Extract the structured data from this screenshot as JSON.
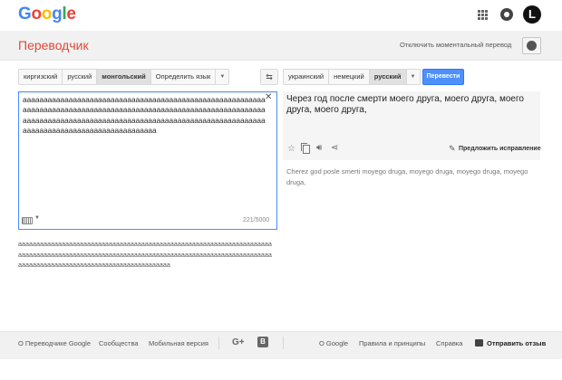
{
  "header": {
    "logo": [
      "G",
      "o",
      "o",
      "g",
      "l",
      "e"
    ],
    "logo_colors": [
      "#4285f4",
      "#ea4335",
      "#fbbc05",
      "#4285f4",
      "#34a853",
      "#ea4335"
    ],
    "avatar_letter": "L"
  },
  "titlebar": {
    "title": "Переводчик",
    "instant_toggle": "Отключить моментальный перевод"
  },
  "source_langs": [
    "киргизский",
    "русский",
    "монгольский",
    "Определить язык"
  ],
  "target_langs": [
    "украинский",
    "немецкий",
    "русский"
  ],
  "swap_label": "⇆",
  "translate_button": "Перевести",
  "source": {
    "text": "aaaaaaaaaaaaaaaaaaaaaaaaaaaaaaaaaaaaaaaaaaaaaaaaaaaaaaaaaaaaaaaaaaaaaaaaaaaaaaaaaaaaaaaaaaaaaaaaaaaaaaaaaaaaaaaaaaaaaaaaaaaaaaaaaaaaaaaaaaaaaaaaaaaaaaaaaaaaaaaaaaaaaaaaaaaaaaaaaaaaaaaaaaaaaaaaaaaaaaaaaaaaaa",
    "char_count": "221/5000",
    "below_text": "aaaaaaaaaaaaaaaaaaaaaaaaaaaaaaaaaaaaaaaaaaaaaaaaaaaaaaaaaaaaaaaaaaaaaaaaaaaaaaaaaaaaaaaaaaaaaaaaaaaaaaaaaaaaaaaaaaaaaaaaaaaaaaaaaaaaaaaaaaaaaaaaaaaaaaaaaaaaaaaaaaaaaaaaaaaaaaaaaaaaaa"
  },
  "result": {
    "text": "Через год после смерти моего друга, моего друга, моего друга, моего друга,",
    "suggest_edit": "Предложить исправление",
    "transliteration": "Cherez god posle smerti moyego druga, moyego druga, moyego druga, moyego druga,"
  },
  "footer": {
    "about": "О Переводчике Google",
    "community": "Сообщества",
    "mobile": "Мобильная версия",
    "google_plus": "G+",
    "blogger": "B",
    "about_google": "О Google",
    "privacy": "Правила и принципы",
    "help": "Справка",
    "feedback": "Отправить отзыв"
  }
}
